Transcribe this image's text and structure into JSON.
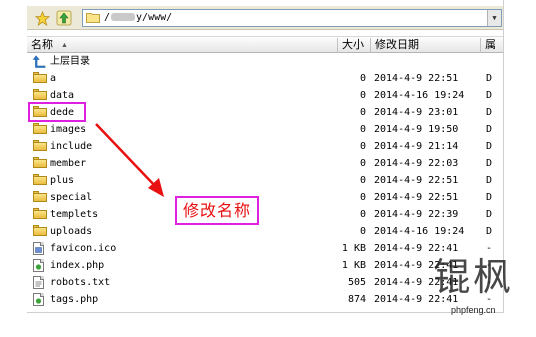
{
  "address_bar": {
    "path_prefix": "/",
    "path_suffix": "y/www/"
  },
  "columns": {
    "name": "名称",
    "size": "大小",
    "modified": "修改日期",
    "permissions": "属"
  },
  "files": [
    {
      "name": "上层目录",
      "type": "parent",
      "size": "",
      "date": "",
      "perm": ""
    },
    {
      "name": "a",
      "type": "folder",
      "size": "0",
      "date": "2014-4-9 22:51",
      "perm": "D"
    },
    {
      "name": "data",
      "type": "folder",
      "size": "0",
      "date": "2014-4-16 19:24",
      "perm": "D"
    },
    {
      "name": "dede",
      "type": "folder",
      "size": "0",
      "date": "2014-4-9 23:01",
      "perm": "D"
    },
    {
      "name": "images",
      "type": "folder",
      "size": "0",
      "date": "2014-4-9 19:50",
      "perm": "D"
    },
    {
      "name": "include",
      "type": "folder",
      "size": "0",
      "date": "2014-4-9 21:14",
      "perm": "D"
    },
    {
      "name": "member",
      "type": "folder",
      "size": "0",
      "date": "2014-4-9 22:03",
      "perm": "D"
    },
    {
      "name": "plus",
      "type": "folder",
      "size": "0",
      "date": "2014-4-9 22:51",
      "perm": "D"
    },
    {
      "name": "special",
      "type": "folder",
      "size": "0",
      "date": "2014-4-9 22:51",
      "perm": "D"
    },
    {
      "name": "templets",
      "type": "folder",
      "size": "0",
      "date": "2014-4-9 22:39",
      "perm": "D"
    },
    {
      "name": "uploads",
      "type": "folder",
      "size": "0",
      "date": "2014-4-16 19:24",
      "perm": "D"
    },
    {
      "name": "favicon.ico",
      "type": "ico",
      "size": "1 KB",
      "date": "2014-4-9 22:41",
      "perm": "-"
    },
    {
      "name": "index.php",
      "type": "php",
      "size": "1 KB",
      "date": "2014-4-9 22:41",
      "perm": "-"
    },
    {
      "name": "robots.txt",
      "type": "txt",
      "size": "505",
      "date": "2014-4-9 22:41",
      "perm": "-"
    },
    {
      "name": "tags.php",
      "type": "php",
      "size": "874",
      "date": "2014-4-9 22:41",
      "perm": "-"
    }
  ],
  "annotation": {
    "callout_text": "修改名称",
    "callout_color": "#e81010",
    "box_color": "#e020e0"
  },
  "watermark": {
    "chars": "锟枫",
    "url": "phpfeng.cn"
  }
}
